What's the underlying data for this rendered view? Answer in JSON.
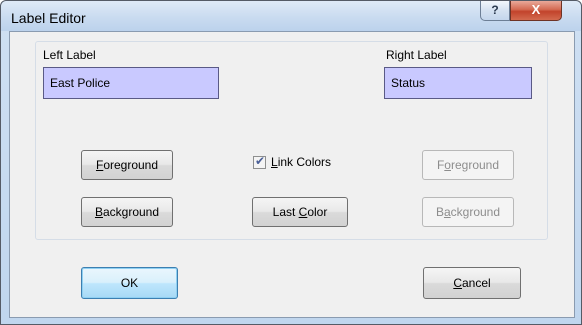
{
  "window": {
    "title": "Label Editor",
    "help_label": "?",
    "close_label": "X"
  },
  "left": {
    "heading": "Left Label",
    "value": "East Police",
    "foreground_first": "F",
    "foreground_rest": "oreground",
    "background_first": "B",
    "background_rest": "ackground"
  },
  "right": {
    "heading": "Right Label",
    "value": "Status",
    "foreground_pre": "F",
    "foreground_u": "o",
    "foreground_rest": "reground",
    "background_pre": "B",
    "background_u": "a",
    "background_rest": "ckground"
  },
  "center": {
    "link_colors_first": "L",
    "link_colors_rest": "ink Colors",
    "link_colors_checked": true,
    "last_color_pre": "Last ",
    "last_color_u": "C",
    "last_color_rest": "olor"
  },
  "footer": {
    "ok_label": "OK",
    "cancel_first": "C",
    "cancel_rest": "ancel"
  },
  "colors": {
    "text_field_bg": "#c9c9ff",
    "close_button": "#c2432b",
    "default_button_border": "#3c7fb1"
  }
}
